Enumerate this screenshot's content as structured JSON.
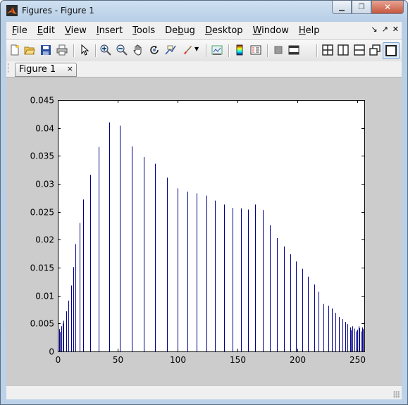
{
  "window": {
    "title": "Figures - Figure 1"
  },
  "menu": [
    {
      "pre": "",
      "u": "F",
      "post": "ile"
    },
    {
      "pre": "",
      "u": "E",
      "post": "dit"
    },
    {
      "pre": "",
      "u": "V",
      "post": "iew"
    },
    {
      "pre": "",
      "u": "I",
      "post": "nsert"
    },
    {
      "pre": "",
      "u": "T",
      "post": "ools"
    },
    {
      "pre": "De",
      "u": "b",
      "post": "ug"
    },
    {
      "pre": "",
      "u": "D",
      "post": "esktop"
    },
    {
      "pre": "",
      "u": "W",
      "post": "indow"
    },
    {
      "pre": "",
      "u": "H",
      "post": "elp"
    }
  ],
  "menu_right": {
    "undock": "↘",
    "dock": "↗",
    "close": "✕"
  },
  "toolbar": {
    "tools": [
      "new-figure-icon",
      "open-icon",
      "save-icon",
      "print-icon",
      "pointer-icon",
      "zoom-in-icon",
      "zoom-out-icon",
      "pan-icon",
      "rotate-3d-icon",
      "data-cursor-icon",
      "brush-icon",
      "link-plot-icon",
      "colorbar-icon",
      "legend-icon",
      "hide-plot-tools-icon",
      "show-plot-tools-icon",
      "tile-icon",
      "left-right-icon",
      "top-bottom-icon",
      "float-icon",
      "maximize-icon"
    ]
  },
  "tab": {
    "label": "Figure 1",
    "close": "×"
  },
  "colors": {
    "bar": "#00008b",
    "axes_bg": "#ffffff",
    "figure_bg": "#cccccc"
  },
  "chart_data": {
    "type": "bar",
    "style": "stem",
    "xlim": [
      0,
      256
    ],
    "ylim": [
      0,
      0.045
    ],
    "xticks": [
      0,
      50,
      100,
      150,
      200,
      250
    ],
    "yticks": [
      0,
      0.005,
      0.01,
      0.015,
      0.02,
      0.025,
      0.03,
      0.035,
      0.04,
      0.045
    ],
    "ytick_labels": [
      "0",
      "0.005",
      "0.01",
      "0.015",
      "0.02",
      "0.025",
      "0.03",
      "0.035",
      "0.04",
      "0.045"
    ],
    "x": [
      1,
      2,
      3,
      4,
      5,
      7,
      9,
      11,
      13,
      15,
      18,
      21,
      27,
      34,
      43,
      52,
      62,
      72,
      81,
      91,
      100,
      108,
      116,
      124,
      131,
      139,
      146,
      153,
      159,
      165,
      171,
      177,
      183,
      189,
      194,
      199,
      204,
      209,
      214,
      218,
      222,
      226,
      229,
      232,
      235,
      238,
      240,
      242,
      244,
      245,
      246,
      248,
      249,
      250,
      251,
      252,
      253,
      254,
      255
    ],
    "values": [
      0.004,
      0.0035,
      0.0045,
      0.005,
      0.0055,
      0.0072,
      0.0091,
      0.0118,
      0.0151,
      0.0192,
      0.023,
      0.0272,
      0.0316,
      0.0366,
      0.041,
      0.0404,
      0.0367,
      0.0348,
      0.0336,
      0.0311,
      0.0292,
      0.0286,
      0.0283,
      0.0279,
      0.027,
      0.0263,
      0.0257,
      0.0256,
      0.0254,
      0.0263,
      0.0253,
      0.0226,
      0.0203,
      0.0188,
      0.0174,
      0.0161,
      0.0148,
      0.0134,
      0.012,
      0.0107,
      0.0085,
      0.0082,
      0.0077,
      0.0069,
      0.0062,
      0.0058,
      0.0053,
      0.0049,
      0.0043,
      0.0038,
      0.0045,
      0.0041,
      0.0036,
      0.0039,
      0.0045,
      0.0042,
      0.0036,
      0.0043,
      0.004
    ],
    "xlabel": "",
    "ylabel": "",
    "title": "",
    "grid": false
  }
}
